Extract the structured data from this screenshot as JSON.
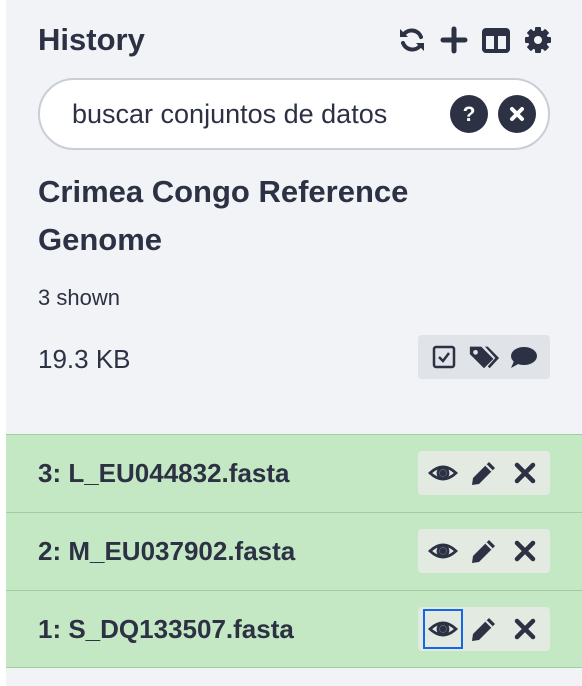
{
  "header": {
    "title": "History",
    "icons": [
      "refresh-icon",
      "plus-icon",
      "columns-icon",
      "gear-icon"
    ]
  },
  "search": {
    "placeholder": "buscar conjuntos de datos",
    "icons": [
      "help-icon",
      "clear-icon"
    ]
  },
  "history": {
    "name": "Crimea Congo Reference Genome",
    "shown": "3 shown",
    "size": "19.3 KB",
    "actions": [
      "select-checkbox-icon",
      "tags-icon",
      "comment-icon"
    ]
  },
  "datasets": [
    {
      "title": "3: L_EU044832.fasta",
      "state_color": "#c4e8c4"
    },
    {
      "title": "2: M_EU037902.fasta",
      "state_color": "#c4e8c4"
    },
    {
      "title": "1: S_DQ133507.fasta",
      "state_color": "#c4e8c4",
      "focused_action": "eye"
    }
  ],
  "colors": {
    "text": "#2c3143",
    "ok_state": "#c4e8c4",
    "focus": "#1667e6",
    "panel": "#f1f3f6"
  }
}
